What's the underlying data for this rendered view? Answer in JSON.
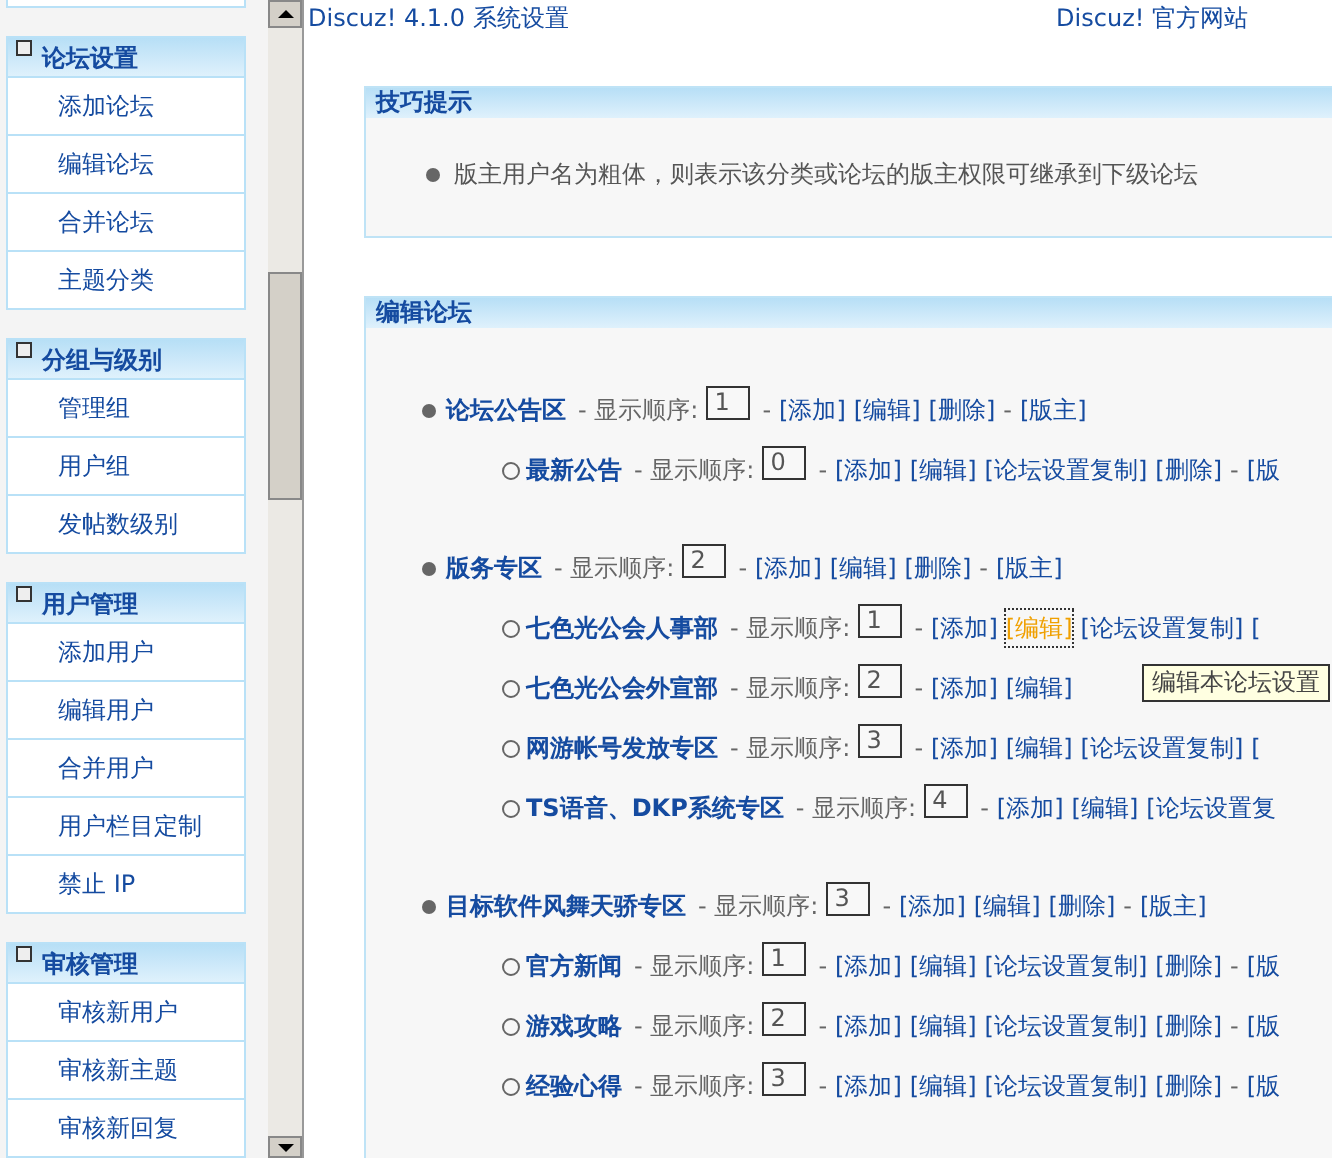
{
  "sidebar": {
    "sections": [
      {
        "title": "论坛设置",
        "items": [
          "添加论坛",
          "编辑论坛",
          "合并论坛",
          "主题分类"
        ]
      },
      {
        "title": "分组与级别",
        "items": [
          "管理组",
          "用户组",
          "发帖数级别"
        ]
      },
      {
        "title": "用户管理",
        "items": [
          "添加用户",
          "编辑用户",
          "合并用户",
          "用户栏目定制",
          "禁止 IP"
        ]
      },
      {
        "title": "审核管理",
        "items": [
          "审核新用户",
          "审核新主题",
          "审核新回复"
        ]
      }
    ]
  },
  "header": {
    "title": "Discuz! 4.1.0 系统设置",
    "link": "Discuz! 官方网站"
  },
  "tips": {
    "title": "技巧提示",
    "items": [
      "版主用户名为粗体，则表示该分类或论坛的版主权限可继承到下级论坛"
    ]
  },
  "edit_forums": {
    "title": "编辑论坛",
    "categories": [
      {
        "name": "论坛公告区",
        "order_label": "- 显示顺序:",
        "order": "1",
        "actions": [
          {
            "kind": "dash",
            "label": "-"
          },
          {
            "kind": "link",
            "label": "[添加]",
            "focused": false
          },
          {
            "kind": "link",
            "label": "[编辑]",
            "focused": false
          },
          {
            "kind": "link",
            "label": "[删除]",
            "focused": false
          },
          {
            "kind": "dash",
            "label": "-"
          },
          {
            "kind": "link",
            "label": "[版主]",
            "focused": false
          }
        ],
        "children": [
          {
            "name": "最新公告",
            "order_label": "- 显示顺序:",
            "order": "0",
            "actions": [
              {
                "kind": "dash",
                "label": "-"
              },
              {
                "kind": "link",
                "label": "[添加]",
                "focused": false
              },
              {
                "kind": "link",
                "label": "[编辑]",
                "focused": false
              },
              {
                "kind": "link",
                "label": "[论坛设置复制]",
                "focused": false
              },
              {
                "kind": "link",
                "label": "[删除]",
                "focused": false
              },
              {
                "kind": "dash",
                "label": "-"
              },
              {
                "kind": "link",
                "label": "[版",
                "focused": false
              }
            ]
          }
        ]
      },
      {
        "name": "版务专区",
        "order_label": "- 显示顺序:",
        "order": "2",
        "actions": [
          {
            "kind": "dash",
            "label": "-"
          },
          {
            "kind": "link",
            "label": "[添加]",
            "focused": false
          },
          {
            "kind": "link",
            "label": "[编辑]",
            "focused": false
          },
          {
            "kind": "link",
            "label": "[删除]",
            "focused": false
          },
          {
            "kind": "dash",
            "label": "-"
          },
          {
            "kind": "link",
            "label": "[版主]",
            "focused": false
          }
        ],
        "children": [
          {
            "name": "七色光公会人事部",
            "order_label": "- 显示顺序:",
            "order": "1",
            "actions": [
              {
                "kind": "dash",
                "label": "-"
              },
              {
                "kind": "link",
                "label": "[添加]",
                "focused": false
              },
              {
                "kind": "link",
                "label": "[编辑]",
                "focused": true
              },
              {
                "kind": "link",
                "label": "[论坛设置复制]",
                "focused": false
              },
              {
                "kind": "link",
                "label": "[",
                "focused": false
              }
            ]
          },
          {
            "name": "七色光公会外宣部",
            "order_label": "- 显示顺序:",
            "order": "2",
            "actions": [
              {
                "kind": "dash",
                "label": "-"
              },
              {
                "kind": "link",
                "label": "[添加]",
                "focused": false
              },
              {
                "kind": "link",
                "label": "[编辑]",
                "focused": false
              }
            ]
          },
          {
            "name": "网游帐号发放专区",
            "order_label": "- 显示顺序:",
            "order": "3",
            "actions": [
              {
                "kind": "dash",
                "label": "-"
              },
              {
                "kind": "link",
                "label": "[添加]",
                "focused": false
              },
              {
                "kind": "link",
                "label": "[编辑]",
                "focused": false
              },
              {
                "kind": "link",
                "label": "[论坛设置复制]",
                "focused": false
              },
              {
                "kind": "link",
                "label": "[",
                "focused": false
              }
            ]
          },
          {
            "name": "TS语音、DKP系统专区",
            "order_label": "- 显示顺序:",
            "order": "4",
            "actions": [
              {
                "kind": "dash",
                "label": "-"
              },
              {
                "kind": "link",
                "label": "[添加]",
                "focused": false
              },
              {
                "kind": "link",
                "label": "[编辑]",
                "focused": false
              },
              {
                "kind": "link",
                "label": "[论坛设置复",
                "focused": false
              }
            ]
          }
        ]
      },
      {
        "name": "目标软件风舞天骄专区",
        "order_label": "- 显示顺序:",
        "order": "3",
        "actions": [
          {
            "kind": "dash",
            "label": "-"
          },
          {
            "kind": "link",
            "label": "[添加]",
            "focused": false
          },
          {
            "kind": "link",
            "label": "[编辑]",
            "focused": false
          },
          {
            "kind": "link",
            "label": "[删除]",
            "focused": false
          },
          {
            "kind": "dash",
            "label": "-"
          },
          {
            "kind": "link",
            "label": "[版主]",
            "focused": false
          }
        ],
        "children": [
          {
            "name": "官方新闻",
            "order_label": "- 显示顺序:",
            "order": "1",
            "actions": [
              {
                "kind": "dash",
                "label": "-"
              },
              {
                "kind": "link",
                "label": "[添加]",
                "focused": false
              },
              {
                "kind": "link",
                "label": "[编辑]",
                "focused": false
              },
              {
                "kind": "link",
                "label": "[论坛设置复制]",
                "focused": false
              },
              {
                "kind": "link",
                "label": "[删除]",
                "focused": false
              },
              {
                "kind": "dash",
                "label": "-"
              },
              {
                "kind": "link",
                "label": "[版",
                "focused": false
              }
            ]
          },
          {
            "name": "游戏攻略",
            "order_label": "- 显示顺序:",
            "order": "2",
            "actions": [
              {
                "kind": "dash",
                "label": "-"
              },
              {
                "kind": "link",
                "label": "[添加]",
                "focused": false
              },
              {
                "kind": "link",
                "label": "[编辑]",
                "focused": false
              },
              {
                "kind": "link",
                "label": "[论坛设置复制]",
                "focused": false
              },
              {
                "kind": "link",
                "label": "[删除]",
                "focused": false
              },
              {
                "kind": "dash",
                "label": "-"
              },
              {
                "kind": "link",
                "label": "[版",
                "focused": false
              }
            ]
          },
          {
            "name": "经验心得",
            "order_label": "- 显示顺序:",
            "order": "3",
            "actions": [
              {
                "kind": "dash",
                "label": "-"
              },
              {
                "kind": "link",
                "label": "[添加]",
                "focused": false
              },
              {
                "kind": "link",
                "label": "[编辑]",
                "focused": false
              },
              {
                "kind": "link",
                "label": "[论坛设置复制]",
                "focused": false
              },
              {
                "kind": "link",
                "label": "[删除]",
                "focused": false
              },
              {
                "kind": "dash",
                "label": "-"
              },
              {
                "kind": "link",
                "label": "[版",
                "focused": false
              }
            ]
          }
        ]
      }
    ]
  },
  "tooltip": {
    "text": "编辑本论坛设置"
  }
}
